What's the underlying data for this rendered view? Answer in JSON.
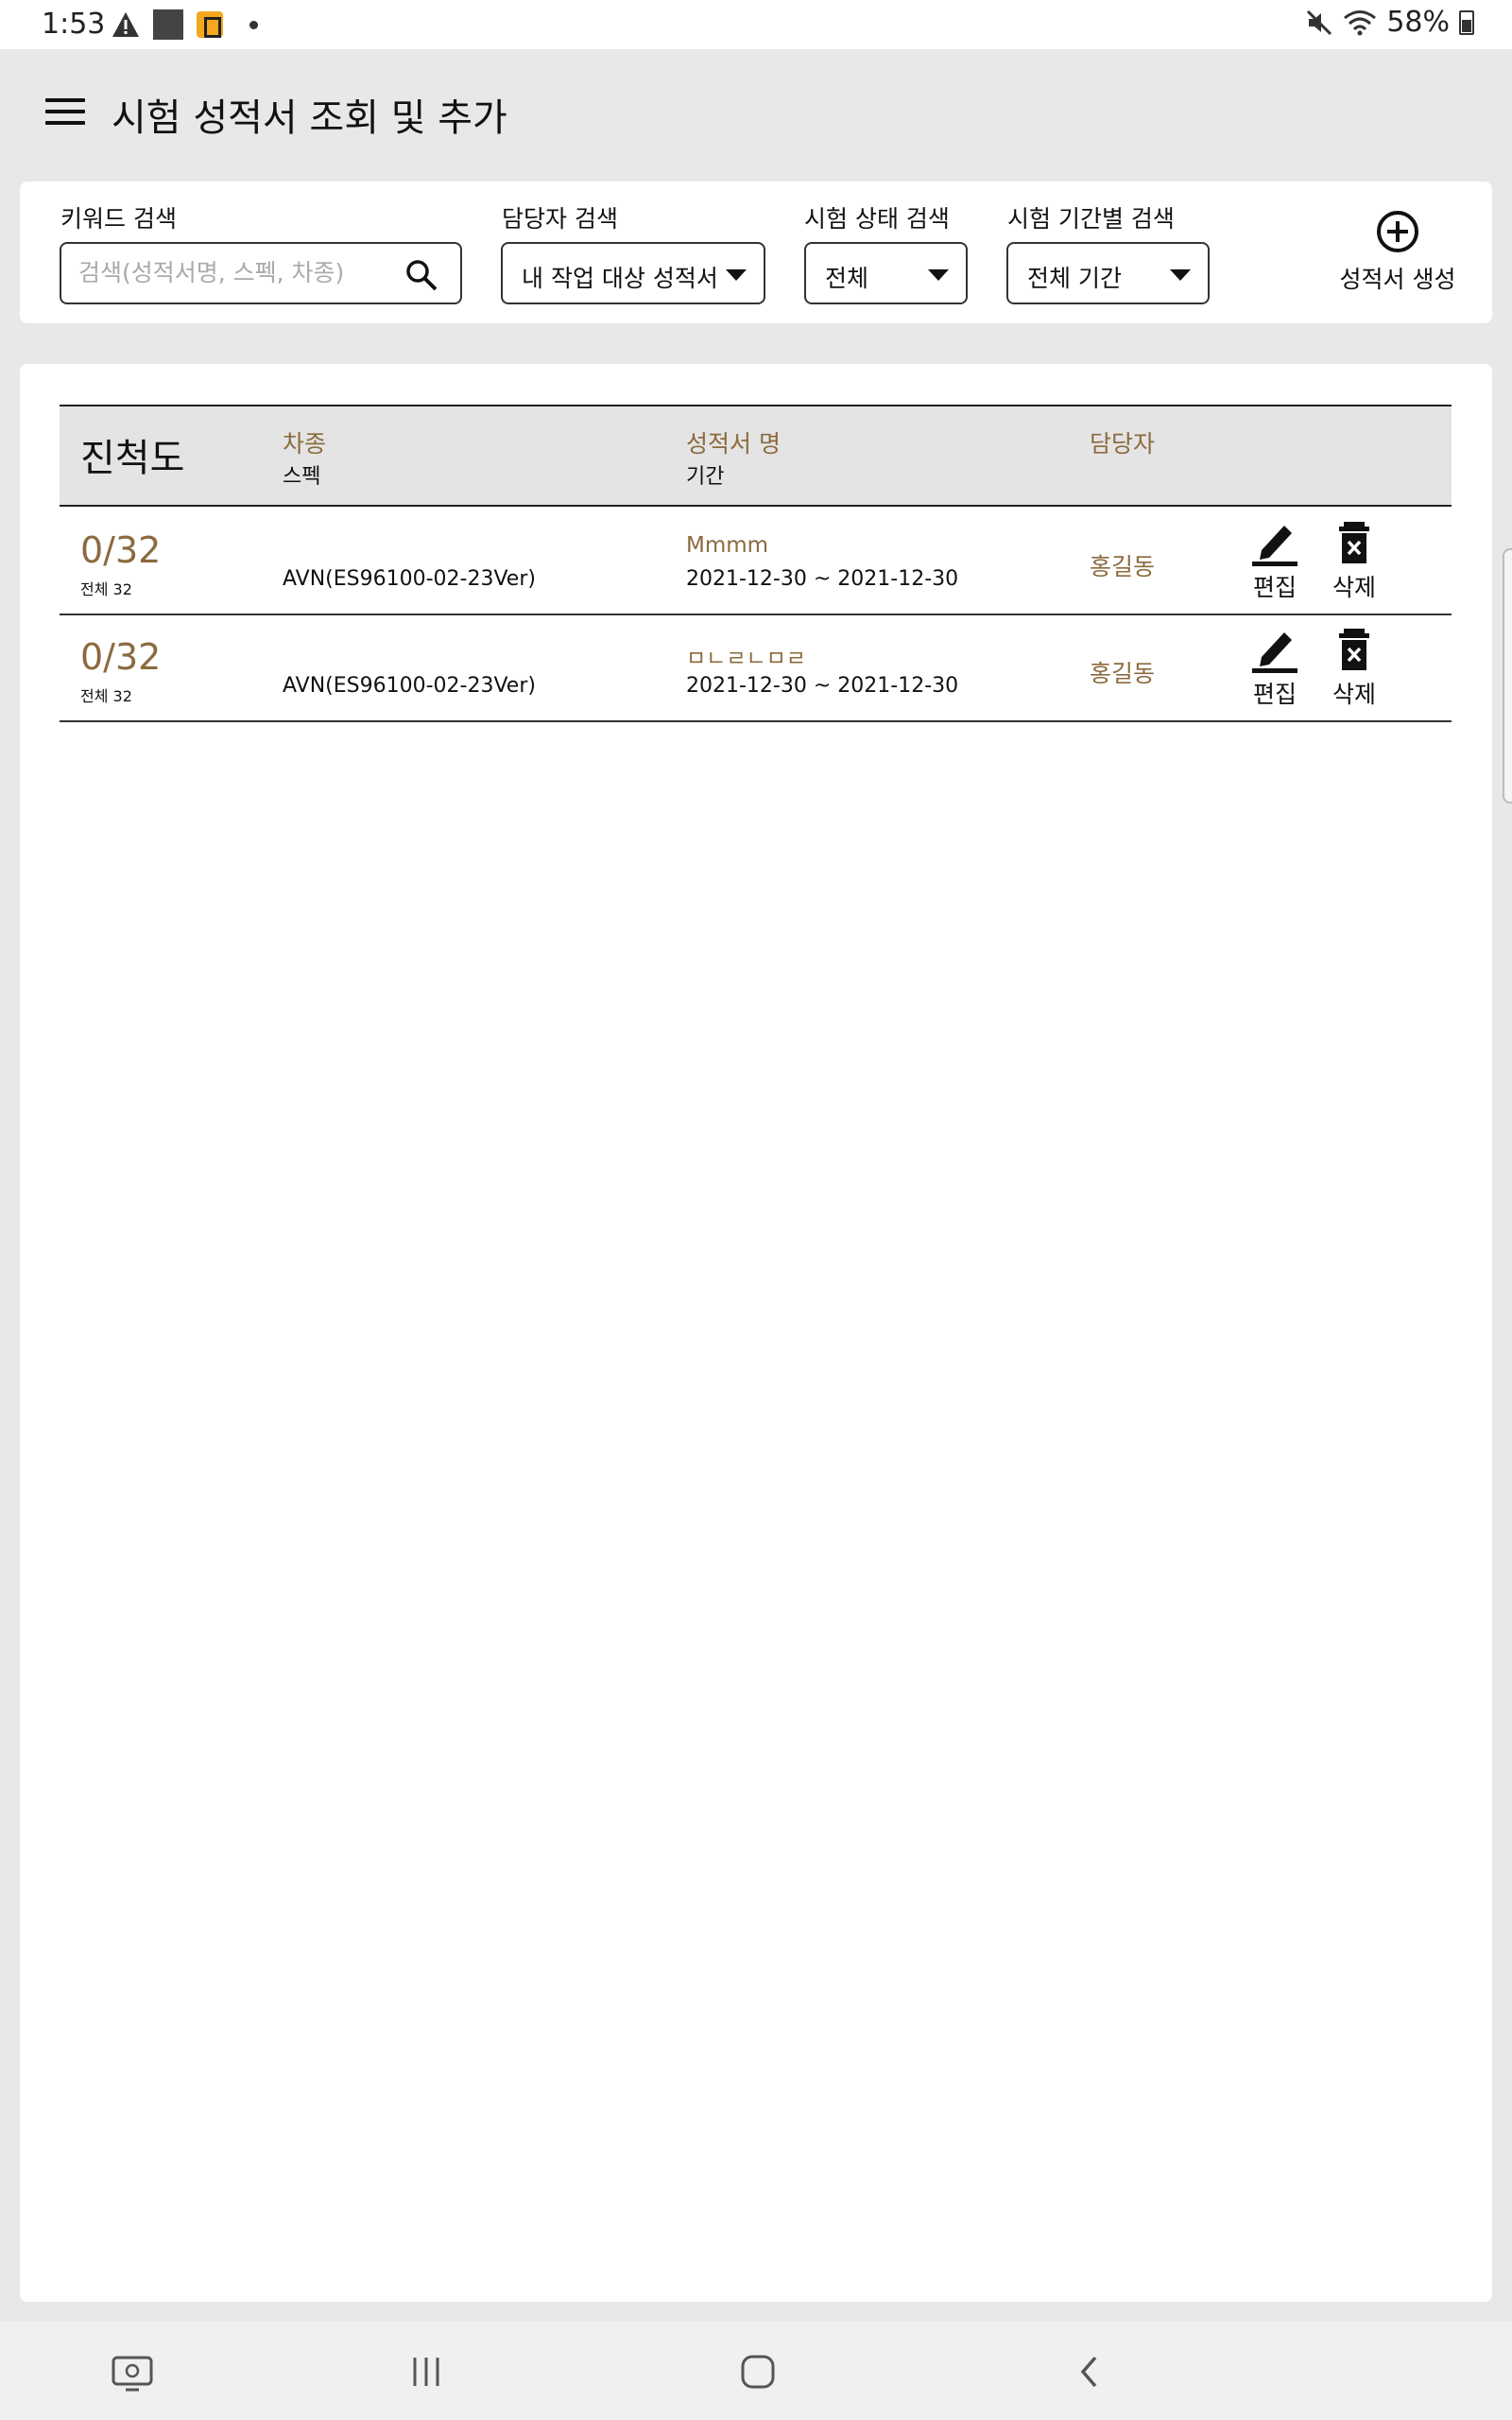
{
  "status_bar": {
    "time": "1:53",
    "battery": "58%",
    "icons": [
      "warning-icon",
      "app-square-icon",
      "app-notification-icon",
      "dot-icon",
      "mute-icon",
      "wifi-icon",
      "battery-icon"
    ]
  },
  "header": {
    "title": "시험 성적서 조회 및 추가",
    "menu_icon": "hamburger-menu-icon"
  },
  "filters": {
    "keyword": {
      "label": "키워드 검색",
      "value": "",
      "placeholder": "검색(성적서명, 스펙, 차종)",
      "icon": "search-icon"
    },
    "owner": {
      "label": "담당자 검색",
      "selected": "내 작업 대상 성적서"
    },
    "status": {
      "label": "시험 상태 검색",
      "selected": "전체"
    },
    "period": {
      "label": "시험 기간별 검색",
      "selected": "전체 기간"
    },
    "create_button": {
      "label": "성적서 생성",
      "icon": "add-circle-icon"
    }
  },
  "table": {
    "headers": {
      "progress": "진척도",
      "vehicle": "차종",
      "spec": "스펙",
      "report_name": "성적서 명",
      "period": "기간",
      "owner": "담당자"
    },
    "rows": [
      {
        "progress": "0/32",
        "total": "전체 32",
        "vehicle": "",
        "spec": "AVN(ES96100-02-23Ver)",
        "report_name": "Mmmm",
        "period": "2021-12-30 ~ 2021-12-30",
        "owner": "홍길동",
        "edit_label": "편집",
        "delete_label": "삭제"
      },
      {
        "progress": "0/32",
        "total": "전체 32",
        "vehicle": "",
        "spec": "AVN(ES96100-02-23Ver)",
        "report_name": "ㅁㄴㄹㄴㅁㄹ",
        "period": "2021-12-30 ~ 2021-12-30",
        "owner": "홍길동",
        "edit_label": "편집",
        "delete_label": "삭제"
      }
    ]
  },
  "nav_bar": {
    "buttons": [
      "recent-apps-screen-icon",
      "recents-icon",
      "home-icon",
      "back-icon"
    ]
  },
  "colors": {
    "accent": "#8b6a3e",
    "background": "#e8e8e8",
    "card": "#ffffff",
    "header_row": "#e4e4e4"
  }
}
